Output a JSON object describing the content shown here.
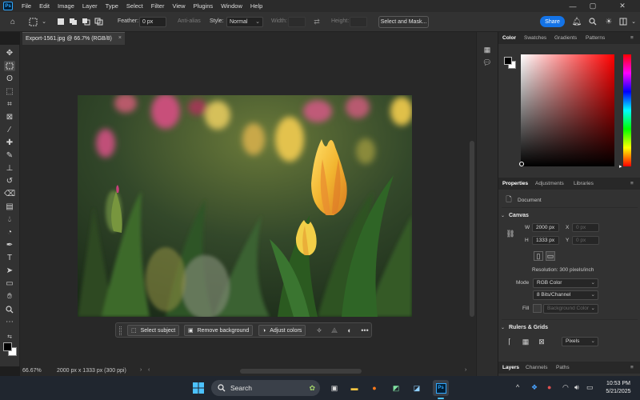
{
  "menubar": {
    "app_icon": "Ps",
    "items": [
      "File",
      "Edit",
      "Image",
      "Layer",
      "Type",
      "Select",
      "Filter",
      "View",
      "Plugins",
      "Window",
      "Help"
    ]
  },
  "options": {
    "feather_label": "Feather:",
    "feather_value": "0 px",
    "antialias_label": "Anti-alias",
    "style_label": "Style:",
    "style_value": "Normal",
    "width_label": "Width:",
    "height_label": "Height:",
    "select_mask_label": "Select and Mask...",
    "share_label": "Share"
  },
  "document": {
    "tab_title": "Export-1561.jpg @ 66.7% (RGB/8)",
    "close_glyph": "×"
  },
  "context_bar": {
    "select_subject": "Select subject",
    "remove_background": "Remove background",
    "adjust_colors": "Adjust colors",
    "more": "•••"
  },
  "status": {
    "zoom": "66.67%",
    "doc_info": "2000 px x 1333 px (300 ppi)"
  },
  "color_panel": {
    "tabs": [
      "Color",
      "Swatches",
      "Gradients",
      "Patterns"
    ],
    "hue_color": "#ff0000"
  },
  "properties": {
    "tabs": [
      "Properties",
      "Adjustments",
      "Libraries"
    ],
    "doc_label": "Document",
    "canvas_title": "Canvas",
    "w_label": "W",
    "w_value": "2000 px",
    "h_label": "H",
    "h_value": "1333 px",
    "x_label": "X",
    "x_value": "0 px",
    "y_label": "Y",
    "y_value": "0 px",
    "resolution": "Resolution: 300 pixels/inch",
    "mode_label": "Mode",
    "mode_value": "RGB Color",
    "bits_value": "8 Bits/Channel",
    "fill_label": "Fill",
    "fill_value": "Background Color",
    "rulers_title": "Rulers & Grids",
    "units_value": "Pixels"
  },
  "layers_panel": {
    "tabs": [
      "Layers",
      "Channels",
      "Paths"
    ]
  },
  "windows_taskbar": {
    "search_placeholder": "Search",
    "time": "10:53 PM",
    "date": "5/21/2025"
  },
  "colors": {
    "accent": "#1473e6",
    "panel_bg": "#323232",
    "canvas_bg": "#282828"
  }
}
